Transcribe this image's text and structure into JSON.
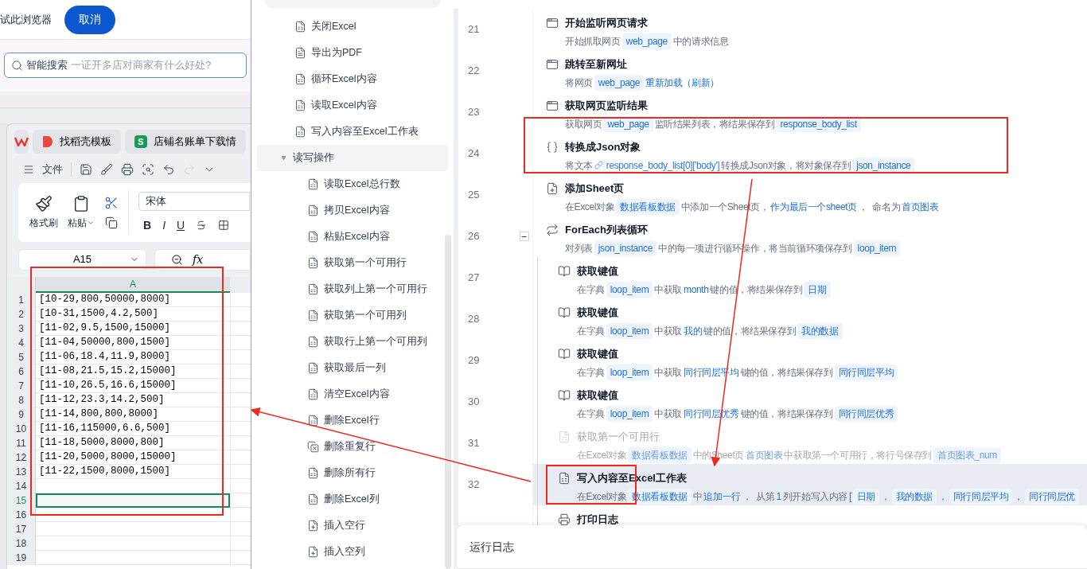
{
  "browser": {
    "prompt": "试此浏览器",
    "cancel_button": "取消",
    "search": {
      "label": "智能搜索",
      "placeholder": "一证开多店对商家有什么好处?"
    }
  },
  "spreadsheet_window": {
    "tabs": [
      {
        "label": "找稻壳模板",
        "kind": "template"
      },
      {
        "label": "店铺名账单下载情",
        "kind": "sheet",
        "badge": "S"
      }
    ],
    "file_menu": "文件",
    "ribbon": {
      "format_painter": "格式刷",
      "paste": "粘贴",
      "font": "宋体",
      "format_buttons": [
        "B",
        "I",
        "U"
      ]
    },
    "name_box": "A15",
    "formula_label": "fx",
    "column_header": "A",
    "rows": [
      {
        "number": "1",
        "value": "[10-29,800,50000,8000]",
        "selected": false
      },
      {
        "number": "2",
        "value": "[10-31,1500,4.2,500]",
        "selected": false
      },
      {
        "number": "3",
        "value": "[11-02,9.5,1500,15000]",
        "selected": false
      },
      {
        "number": "4",
        "value": "[11-04,50000,800,1500]",
        "selected": false
      },
      {
        "number": "5",
        "value": "[11-06,18.4,11.9,8000]",
        "selected": false
      },
      {
        "number": "6",
        "value": "[11-08,21.5,15.2,15000]",
        "selected": false
      },
      {
        "number": "7",
        "value": "[11-10,26.5,16.6,15000]",
        "selected": false
      },
      {
        "number": "8",
        "value": "[11-12,23.3,14.2,500]",
        "selected": false
      },
      {
        "number": "9",
        "value": "[11-14,800,800,8000]",
        "selected": false
      },
      {
        "number": "10",
        "value": "[11-16,115000,6.6,500]",
        "selected": false
      },
      {
        "number": "11",
        "value": "[11-18,5000,8000,800]",
        "selected": false
      },
      {
        "number": "12",
        "value": "[11-20,5000,8000,15000]",
        "selected": false
      },
      {
        "number": "13",
        "value": "[11-22,1500,8000,1500]",
        "selected": false
      },
      {
        "number": "14",
        "selected": false
      },
      {
        "number": "15",
        "selected": true
      },
      {
        "number": "16",
        "selected": false
      },
      {
        "number": "17",
        "selected": false
      },
      {
        "number": "18",
        "selected": false
      },
      {
        "number": "19",
        "selected": false
      }
    ]
  },
  "actions": [
    {
      "label": "关闭Excel",
      "kind": "excel"
    },
    {
      "label": "导出为PDF",
      "kind": "pdf"
    },
    {
      "label": "循环Excel内容",
      "kind": "excel"
    },
    {
      "label": "读取Excel内容",
      "kind": "excel"
    },
    {
      "label": "写入内容至Excel工作表",
      "kind": "excel"
    },
    {
      "label": "读写操作",
      "kind": "group",
      "expanded": true,
      "children": [
        {
          "label": "读取Excel总行数",
          "kind": "excel"
        },
        {
          "label": "拷贝Excel内容",
          "kind": "excel"
        },
        {
          "label": "粘贴Excel内容",
          "kind": "excel"
        },
        {
          "label": "获取第一个可用行",
          "kind": "excel"
        },
        {
          "label": "获取列上第一个可用行",
          "kind": "excel"
        },
        {
          "label": "获取第一个可用列",
          "kind": "excel"
        },
        {
          "label": "获取行上第一个可用列",
          "kind": "excel"
        },
        {
          "label": "获取最后一列",
          "kind": "excel"
        },
        {
          "label": "清空Excel内容",
          "kind": "excel"
        },
        {
          "label": "删除Excel行",
          "kind": "excel"
        },
        {
          "label": "删除重复行",
          "kind": "dedupe"
        },
        {
          "label": "删除所有行",
          "kind": "excel"
        },
        {
          "label": "删除Excel列",
          "kind": "excel"
        },
        {
          "label": "插入空行",
          "kind": "insert"
        },
        {
          "label": "插入空列",
          "kind": "insert"
        }
      ]
    }
  ],
  "steps": [
    {
      "line": "21",
      "title": "开始监听网页请求",
      "kind": "browser",
      "disabled": false,
      "selected": false,
      "parts": [
        {
          "kind": "text",
          "text": "开始抓取网页"
        },
        {
          "kind": "var",
          "text": "web_page"
        },
        {
          "kind": "text",
          "text": "中的请求信息"
        }
      ]
    },
    {
      "line": "22",
      "title": "跳转至新网址",
      "kind": "browser",
      "disabled": false,
      "selected": false,
      "parts": [
        {
          "kind": "text",
          "text": "将网页"
        },
        {
          "kind": "var",
          "text": "web_page"
        },
        {
          "kind": "value",
          "text": "重新加载（刷新）"
        }
      ]
    },
    {
      "line": "23",
      "title": "获取网页监听结果",
      "kind": "browser",
      "disabled": false,
      "selected": false,
      "parts": [
        {
          "kind": "text",
          "text": "获取网页"
        },
        {
          "kind": "var",
          "text": "web_page"
        },
        {
          "kind": "text",
          "text": "监听结果列表，将结果保存到"
        },
        {
          "kind": "var",
          "text": "response_body_list"
        }
      ]
    },
    {
      "line": "24",
      "title": "转换成Json对象",
      "kind": "json",
      "disabled": false,
      "selected": false,
      "parts": [
        {
          "kind": "text",
          "text": "将文本"
        },
        {
          "kind": "expr",
          "text": "response_body_list[0]['body']"
        },
        {
          "kind": "text",
          "text": "转换成Json对象，将对象保存到"
        },
        {
          "kind": "var",
          "text": "json_instance"
        }
      ]
    },
    {
      "line": "25",
      "title": "添加Sheet页",
      "kind": "sheet",
      "disabled": false,
      "selected": false,
      "parts": [
        {
          "kind": "text",
          "text": "在Excel对象"
        },
        {
          "kind": "var",
          "text": "数据看板数据"
        },
        {
          "kind": "text",
          "text": "中添加一个Sheet页，"
        },
        {
          "kind": "value",
          "text": "作为最后一个sheet页"
        },
        {
          "kind": "text",
          "text": "，  命名为"
        },
        {
          "kind": "value",
          "text": "首页图表"
        }
      ]
    },
    {
      "line": "26",
      "title": "ForEach列表循环",
      "kind": "loop",
      "disabled": false,
      "selected": false,
      "expanded": true,
      "parts": [
        {
          "kind": "text",
          "text": "对列表"
        },
        {
          "kind": "var",
          "text": "json_instance"
        },
        {
          "kind": "text",
          "text": "中的每一项进行循环操作，将当前循环项保存到"
        },
        {
          "kind": "var",
          "text": "loop_item"
        }
      ],
      "children": [
        {
          "line": "27",
          "title": "获取键值",
          "kind": "dict",
          "disabled": false,
          "selected": false,
          "parts": [
            {
              "kind": "text",
              "text": "在字典"
            },
            {
              "kind": "var",
              "text": "loop_item"
            },
            {
              "kind": "text",
              "text": "中获取"
            },
            {
              "kind": "value",
              "text": "month"
            },
            {
              "kind": "text",
              "text": "键的值，将结果保存到"
            },
            {
              "kind": "var",
              "text": "日期"
            }
          ]
        },
        {
          "line": "28",
          "title": "获取键值",
          "kind": "dict",
          "disabled": false,
          "selected": false,
          "parts": [
            {
              "kind": "text",
              "text": "在字典"
            },
            {
              "kind": "var",
              "text": "loop_item"
            },
            {
              "kind": "text",
              "text": "中获取"
            },
            {
              "kind": "value",
              "text": "我的"
            },
            {
              "kind": "text",
              "text": "键的值，将结果保存到"
            },
            {
              "kind": "var",
              "text": "我的数据"
            }
          ]
        },
        {
          "line": "29",
          "title": "获取键值",
          "kind": "dict",
          "disabled": false,
          "selected": false,
          "parts": [
            {
              "kind": "text",
              "text": "在字典"
            },
            {
              "kind": "var",
              "text": "loop_item"
            },
            {
              "kind": "text",
              "text": "中获取"
            },
            {
              "kind": "value",
              "text": "同行同层平均"
            },
            {
              "kind": "text",
              "text": "键的值，将结果保存到"
            },
            {
              "kind": "var",
              "text": "同行同层平均"
            }
          ]
        },
        {
          "line": "30",
          "title": "获取键值",
          "kind": "dict",
          "disabled": false,
          "selected": false,
          "parts": [
            {
              "kind": "text",
              "text": "在字典"
            },
            {
              "kind": "var",
              "text": "loop_item"
            },
            {
              "kind": "text",
              "text": "中获取"
            },
            {
              "kind": "value",
              "text": "同行同层优秀"
            },
            {
              "kind": "text",
              "text": "键的值，将结果保存到"
            },
            {
              "kind": "var",
              "text": "同行同层优秀"
            }
          ]
        },
        {
          "line": "31",
          "title": "获取第一个可用行",
          "kind": "excel",
          "disabled": true,
          "selected": false,
          "parts": [
            {
              "kind": "text",
              "text": "在Excel对象"
            },
            {
              "kind": "var",
              "text": "数据看板数据"
            },
            {
              "kind": "text",
              "text": "中的Sheet页"
            },
            {
              "kind": "value",
              "text": "首页图表"
            },
            {
              "kind": "text",
              "text": "中获取第一个可用行，将行号保存到"
            },
            {
              "kind": "var",
              "text": "首页图表_num"
            }
          ]
        },
        {
          "line": "32",
          "title": "写入内容至Excel工作表",
          "kind": "excel",
          "disabled": false,
          "selected": true,
          "parts": [
            {
              "kind": "text",
              "text": "在Excel对象"
            },
            {
              "kind": "var",
              "text": "数据看板数据"
            },
            {
              "kind": "text",
              "text": "中"
            },
            {
              "kind": "value",
              "text": "追加一行"
            },
            {
              "kind": "text",
              "text": "，  从第"
            },
            {
              "kind": "value",
              "text": "1"
            },
            {
              "kind": "text",
              "text": "列开始写入内容"
            },
            {
              "kind": "value",
              "text": "["
            },
            {
              "kind": "var",
              "text": "日期"
            },
            {
              "kind": "value",
              "text": "，"
            },
            {
              "kind": "var",
              "text": "我的数据"
            },
            {
              "kind": "value",
              "text": "，"
            },
            {
              "kind": "var",
              "text": "同行同层平均"
            },
            {
              "kind": "value",
              "text": "，"
            },
            {
              "kind": "var",
              "text": "同行同层优"
            }
          ]
        },
        {
          "title": "打印日志",
          "kind": "print",
          "disabled": false,
          "selected": false
        }
      ]
    }
  ],
  "log_panel": {
    "title": "运行日志"
  }
}
